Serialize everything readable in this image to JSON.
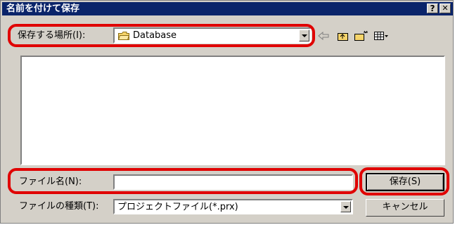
{
  "window": {
    "title": "名前を付けて保存",
    "help_label": "?",
    "close_label": "✕"
  },
  "location": {
    "label": "保存する場所(I):",
    "value": "Database"
  },
  "filename": {
    "label": "ファイル名(N):",
    "value": ""
  },
  "filetype": {
    "label": "ファイルの種類(T):",
    "value": "プロジェクトファイル(*.prx)"
  },
  "buttons": {
    "save": "保存(S)",
    "cancel": "キャンセル"
  },
  "toolbar_icons": [
    "back-arrow-icon",
    "up-folder-icon",
    "new-folder-icon",
    "view-menu-icon"
  ],
  "highlight_color": "#e00000"
}
